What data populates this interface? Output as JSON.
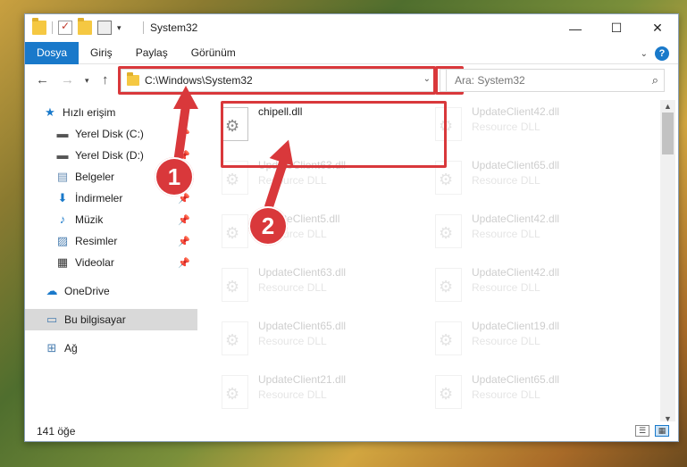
{
  "window": {
    "title": "System32"
  },
  "ribbon": {
    "tabs": [
      {
        "label": "Dosya",
        "active": true
      },
      {
        "label": "Giriş",
        "active": false
      },
      {
        "label": "Paylaş",
        "active": false
      },
      {
        "label": "Görünüm",
        "active": false
      }
    ]
  },
  "address": {
    "path": "C:\\Windows\\System32",
    "search_placeholder": "Ara: System32"
  },
  "sidebar": {
    "items": [
      {
        "label": "Hızlı erişim",
        "icon": "star-icon",
        "pinned": false
      },
      {
        "label": "Yerel Disk (C:)",
        "icon": "drive-icon",
        "pinned": true
      },
      {
        "label": "Yerel Disk (D:)",
        "icon": "drive-icon",
        "pinned": true
      },
      {
        "label": "Belgeler",
        "icon": "documents-icon",
        "pinned": true
      },
      {
        "label": "İndirmeler",
        "icon": "download-icon",
        "pinned": true
      },
      {
        "label": "Müzik",
        "icon": "music-icon",
        "pinned": true
      },
      {
        "label": "Resimler",
        "icon": "pictures-icon",
        "pinned": true
      },
      {
        "label": "Videolar",
        "icon": "videos-icon",
        "pinned": true
      },
      {
        "label": "OneDrive",
        "icon": "cloud-icon",
        "pinned": false
      },
      {
        "label": "Bu bilgisayar",
        "icon": "computer-icon",
        "pinned": false,
        "selected": true
      },
      {
        "label": "Ağ",
        "icon": "network-icon",
        "pinned": false
      }
    ]
  },
  "files": [
    {
      "name": "chipell.dll",
      "type": "",
      "highlighted": true
    },
    {
      "name": "UpdateClient42.dll",
      "type": "Resource DLL"
    },
    {
      "name": "UpdateClient63.dll",
      "type": "Resource DLL"
    },
    {
      "name": "UpdateClient65.dll",
      "type": "Resource DLL"
    },
    {
      "name": "UpdateClient5.dll",
      "type": "Resource DLL"
    },
    {
      "name": "UpdateClient42.dll",
      "type": "Resource DLL"
    },
    {
      "name": "UpdateClient63.dll",
      "type": "Resource DLL"
    },
    {
      "name": "UpdateClient42.dll",
      "type": "Resource DLL"
    },
    {
      "name": "UpdateClient65.dll",
      "type": "Resource DLL"
    },
    {
      "name": "UpdateClient19.dll",
      "type": "Resource DLL"
    },
    {
      "name": "UpdateClient21.dll",
      "type": "Resource DLL"
    },
    {
      "name": "UpdateClient65.dll",
      "type": "Resource DLL"
    }
  ],
  "status": {
    "item_count": "141 öğe"
  },
  "callouts": {
    "one": "1",
    "two": "2"
  },
  "colors": {
    "accent": "#1979ca",
    "callout": "#d9383b"
  }
}
